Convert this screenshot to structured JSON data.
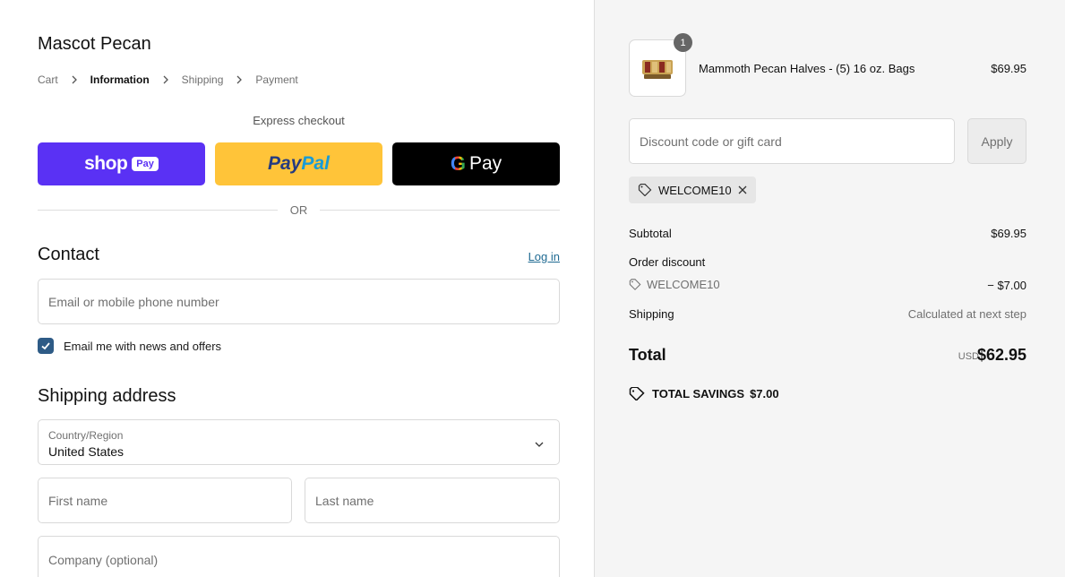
{
  "store": {
    "name": "Mascot Pecan"
  },
  "breadcrumb": {
    "cart": "Cart",
    "information": "Information",
    "shipping": "Shipping",
    "payment": "Payment"
  },
  "express": {
    "label": "Express checkout",
    "shop_word": "shop",
    "shop_pill": "Pay",
    "paypal_part1": "Pay",
    "paypal_part2": "Pal",
    "gpay_g": "G",
    "gpay_word": "Pay",
    "or": "OR"
  },
  "contact": {
    "title": "Contact",
    "login": "Log in",
    "email_placeholder": "Email or mobile phone number",
    "newsletter_label": "Email me with news and offers",
    "newsletter_checked": true
  },
  "shipping_address": {
    "title": "Shipping address",
    "country_label": "Country/Region",
    "country_value": "United States",
    "first_name_placeholder": "First name",
    "last_name_placeholder": "Last name",
    "company_placeholder": "Company (optional)"
  },
  "order": {
    "item": {
      "name": "Mammoth Pecan Halves - (5) 16 oz. Bags",
      "price": "$69.95",
      "quantity": "1"
    },
    "discount_placeholder": "Discount code or gift card",
    "apply": "Apply",
    "applied_code": "WELCOME10",
    "subtotal_label": "Subtotal",
    "subtotal_value": "$69.95",
    "order_discount_label": "Order discount",
    "discount_code": "WELCOME10",
    "discount_value": "− $7.00",
    "shipping_label": "Shipping",
    "shipping_value": "Calculated at next step",
    "total_label": "Total",
    "currency": "USD",
    "total_value": "$62.95",
    "savings_label": "TOTAL SAVINGS",
    "savings_value": "$7.00"
  },
  "colors": {
    "shop": "#5a31f4",
    "paypal": "#ffc439",
    "gpay": "#000000",
    "checkbox": "#2e5b86",
    "link": "#1f6a92"
  }
}
